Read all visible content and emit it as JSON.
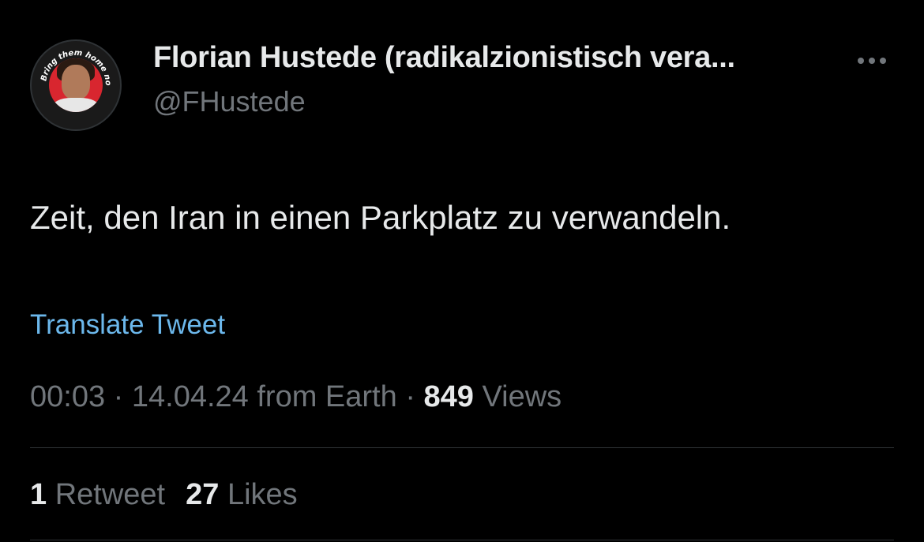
{
  "author": {
    "display_name": "Florian Hustede (radikalzionistisch vera...",
    "handle": "@FHustede",
    "avatar_badge_text": "Bring them home now"
  },
  "tweet": {
    "text": "Zeit, den Iran in einen Parkplatz zu verwandeln.",
    "translate_label": "Translate Tweet",
    "time": "00:03",
    "date": "14.04.24",
    "source": "from Earth",
    "separator": "·",
    "views_count": "849",
    "views_label": "Views"
  },
  "stats": {
    "retweets_count": "1",
    "retweets_label": "Retweet",
    "likes_count": "27",
    "likes_label": "Likes"
  },
  "colors": {
    "background": "#000000",
    "primary_text": "#e7e9ea",
    "secondary_text": "#71767b",
    "link": "#6cb8ec",
    "divider": "#2f3336",
    "avatar_accent": "#d8262f"
  },
  "icons": {
    "more": "more-horizontal-icon"
  }
}
